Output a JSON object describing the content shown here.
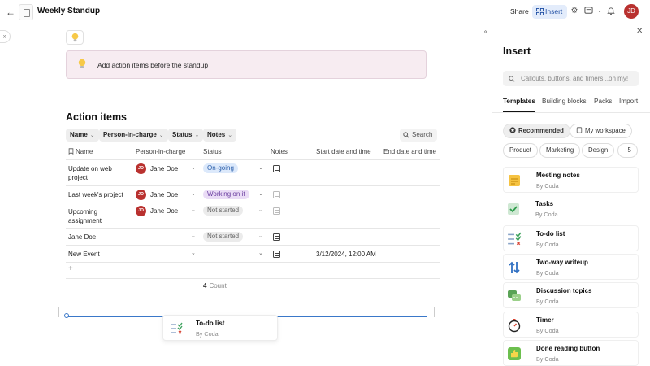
{
  "doc": {
    "title": "Weekly Standup"
  },
  "callout": {
    "text": "Add action items before the standup"
  },
  "table": {
    "title": "Action items",
    "filters": [
      "Name",
      "Person-in-charge",
      "Status",
      "Notes"
    ],
    "search_label": "Search",
    "columns": [
      "Name",
      "Person-in-charge",
      "Status",
      "Notes",
      "Start date and time",
      "End date and time"
    ],
    "rows": [
      {
        "name_lines": [
          "Update on web",
          "project"
        ],
        "person": "Jane Doe",
        "avatar": "JD",
        "status": "On-going",
        "status_color": "#dce9fb",
        "status_text_color": "#2b5fab",
        "notes_filled": true,
        "start": ""
      },
      {
        "name_lines": [
          "Last week's project",
          ""
        ],
        "person": "Jane Doe",
        "avatar": "JD",
        "status": "Working on it",
        "status_color": "#eadcf6",
        "status_text_color": "#6b3fa0",
        "notes_filled": false,
        "start": ""
      },
      {
        "name_lines": [
          "Upcoming",
          "assignment"
        ],
        "person": "Jane Doe",
        "avatar": "JD",
        "status": "Not started",
        "status_color": "#ebebeb",
        "status_text_color": "#666666",
        "notes_filled": false,
        "start": ""
      },
      {
        "name_lines": [
          "Jane Doe",
          ""
        ],
        "person": "",
        "avatar": "",
        "status": "Not started",
        "status_color": "#ebebeb",
        "status_text_color": "#666666",
        "notes_filled": true,
        "start": ""
      },
      {
        "name_lines": [
          "New Event",
          ""
        ],
        "person": "",
        "avatar": "",
        "status": "",
        "status_color": "",
        "status_text_color": "",
        "notes_filled": true,
        "start": "3/12/2024, 12:00 AM"
      }
    ],
    "add_row": "+",
    "count_value": "4",
    "count_label": "Count"
  },
  "drag_card": {
    "name": "To-do list",
    "by": "By Coda"
  },
  "topbar": {
    "share": "Share",
    "insert": "Insert",
    "user_initials": "JD"
  },
  "panel": {
    "title": "Insert",
    "search_placeholder": "Callouts, buttons, and timers...oh my!",
    "tabs": [
      "Templates",
      "Building blocks",
      "Packs",
      "Import"
    ],
    "chips_row1": [
      "Recommended",
      "My workspace"
    ],
    "chips_row2": [
      "Product",
      "Marketing",
      "Design",
      "+5"
    ],
    "templates": [
      {
        "name": "Meeting notes",
        "by": "By Coda",
        "icon": "notepad-icon"
      },
      {
        "name": "Tasks",
        "by": "By Coda",
        "icon": "checkbox-icon"
      },
      {
        "name": "To-do list",
        "by": "By Coda",
        "icon": "checklist-icon"
      },
      {
        "name": "Two-way writeup",
        "by": "By Coda",
        "icon": "arrows-icon"
      },
      {
        "name": "Discussion topics",
        "by": "By Coda",
        "icon": "speech-bubbles-icon"
      },
      {
        "name": "Timer",
        "by": "By Coda",
        "icon": "stopwatch-icon"
      },
      {
        "name": "Done reading button",
        "by": "By Coda",
        "icon": "thumbs-up-icon"
      }
    ]
  },
  "colors": {
    "accent": "#3a78c9",
    "avatar": "#b9312f",
    "callout_bg": "#f7ecf1",
    "insert_bg": "#e3ecfb"
  }
}
